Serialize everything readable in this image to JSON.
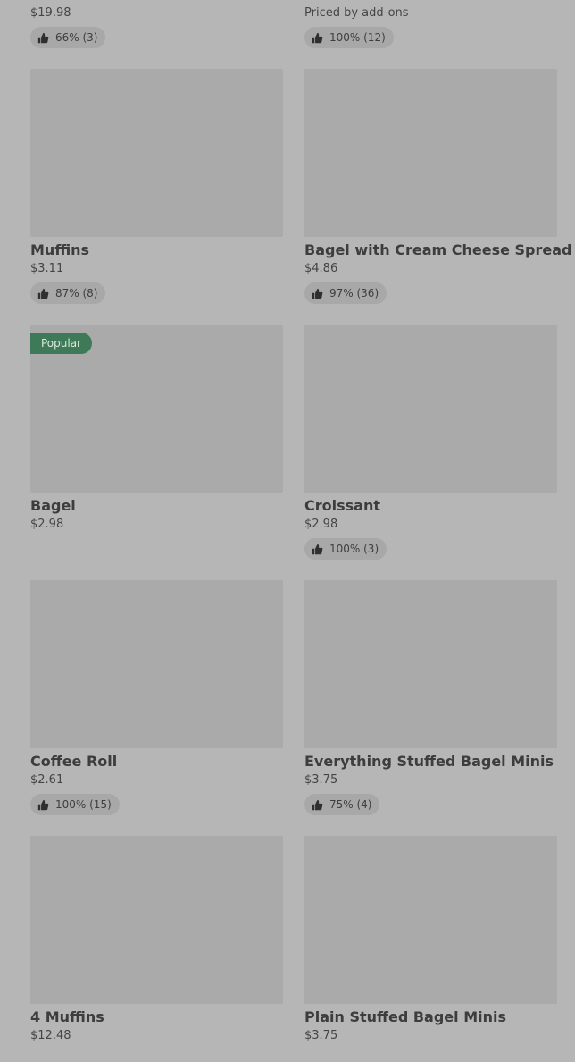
{
  "partial_row": [
    {
      "price": "$19.98",
      "rating": "66% (3)"
    },
    {
      "price": "Priced by add-ons",
      "rating": "100% (12)"
    }
  ],
  "items": [
    {
      "name": "Muffins",
      "price": "$3.11",
      "rating": "87% (8)",
      "badge": ""
    },
    {
      "name": "Bagel with Cream Cheese Spread",
      "price": "$4.86",
      "rating": "97% (36)",
      "badge": ""
    },
    {
      "name": "Bagel",
      "price": "$2.98",
      "rating": "",
      "badge": "Popular"
    },
    {
      "name": "Croissant",
      "price": "$2.98",
      "rating": "100% (3)",
      "badge": ""
    },
    {
      "name": "Coffee Roll",
      "price": "$2.61",
      "rating": "100% (15)",
      "badge": ""
    },
    {
      "name": "Everything Stuffed Bagel Minis",
      "price": "$3.75",
      "rating": "75% (4)",
      "badge": ""
    },
    {
      "name": "4 Muffins",
      "price": "$12.48",
      "rating": "",
      "badge": ""
    },
    {
      "name": "Plain Stuffed Bagel Minis",
      "price": "$3.75",
      "rating": "",
      "badge": ""
    }
  ],
  "icons": {
    "rating": "thumbs-up-icon"
  },
  "colors": {
    "badge_bg": "#3e7a57",
    "overlay": "#b6b6b6",
    "thumb": "#aaaaaa"
  }
}
